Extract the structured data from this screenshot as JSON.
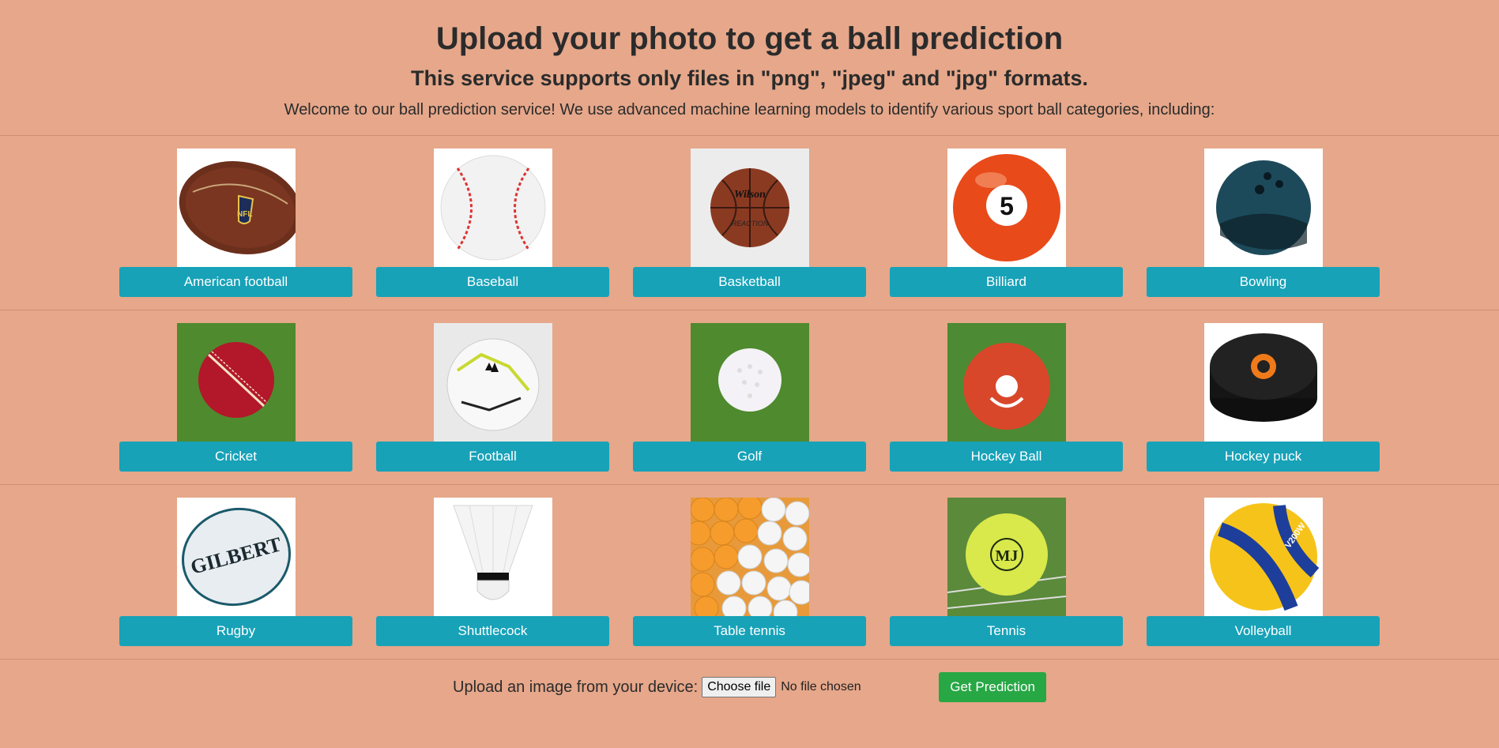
{
  "header": {
    "title": "Upload your photo to get a ball prediction",
    "subtitle": "This service supports only files in \"png\", \"jpeg\" and \"jpg\" formats.",
    "welcome": "Welcome to our ball prediction service! We use advanced machine learning models to identify various sport ball categories, including:"
  },
  "balls": [
    {
      "label": "American football",
      "icon": "american-football-icon"
    },
    {
      "label": "Baseball",
      "icon": "baseball-icon"
    },
    {
      "label": "Basketball",
      "icon": "basketball-icon"
    },
    {
      "label": "Billiard",
      "icon": "billiard-ball-icon"
    },
    {
      "label": "Bowling",
      "icon": "bowling-ball-icon"
    },
    {
      "label": "Cricket",
      "icon": "cricket-ball-icon"
    },
    {
      "label": "Football",
      "icon": "football-icon"
    },
    {
      "label": "Golf",
      "icon": "golf-ball-icon"
    },
    {
      "label": "Hockey Ball",
      "icon": "hockey-ball-icon"
    },
    {
      "label": "Hockey puck",
      "icon": "hockey-puck-icon"
    },
    {
      "label": "Rugby",
      "icon": "rugby-ball-icon"
    },
    {
      "label": "Shuttlecock",
      "icon": "shuttlecock-icon"
    },
    {
      "label": "Table tennis",
      "icon": "table-tennis-balls-icon"
    },
    {
      "label": "Tennis",
      "icon": "tennis-ball-icon"
    },
    {
      "label": "Volleyball",
      "icon": "volleyball-icon"
    }
  ],
  "images": {
    "wilson": "Wilson",
    "reaction": "REACTION",
    "billiard_number": "5",
    "rugby_brand": "GILBERT",
    "tennis_mark": "MJ",
    "volleyball_model": "V200W"
  },
  "upload": {
    "label": "Upload an image from your device:",
    "choose_file": "Choose file",
    "status": "No file chosen",
    "predict": "Get Prediction"
  },
  "colors": {
    "background": "#e6a78a",
    "ball_button": "#17a2b8",
    "predict_button": "#28a745"
  }
}
